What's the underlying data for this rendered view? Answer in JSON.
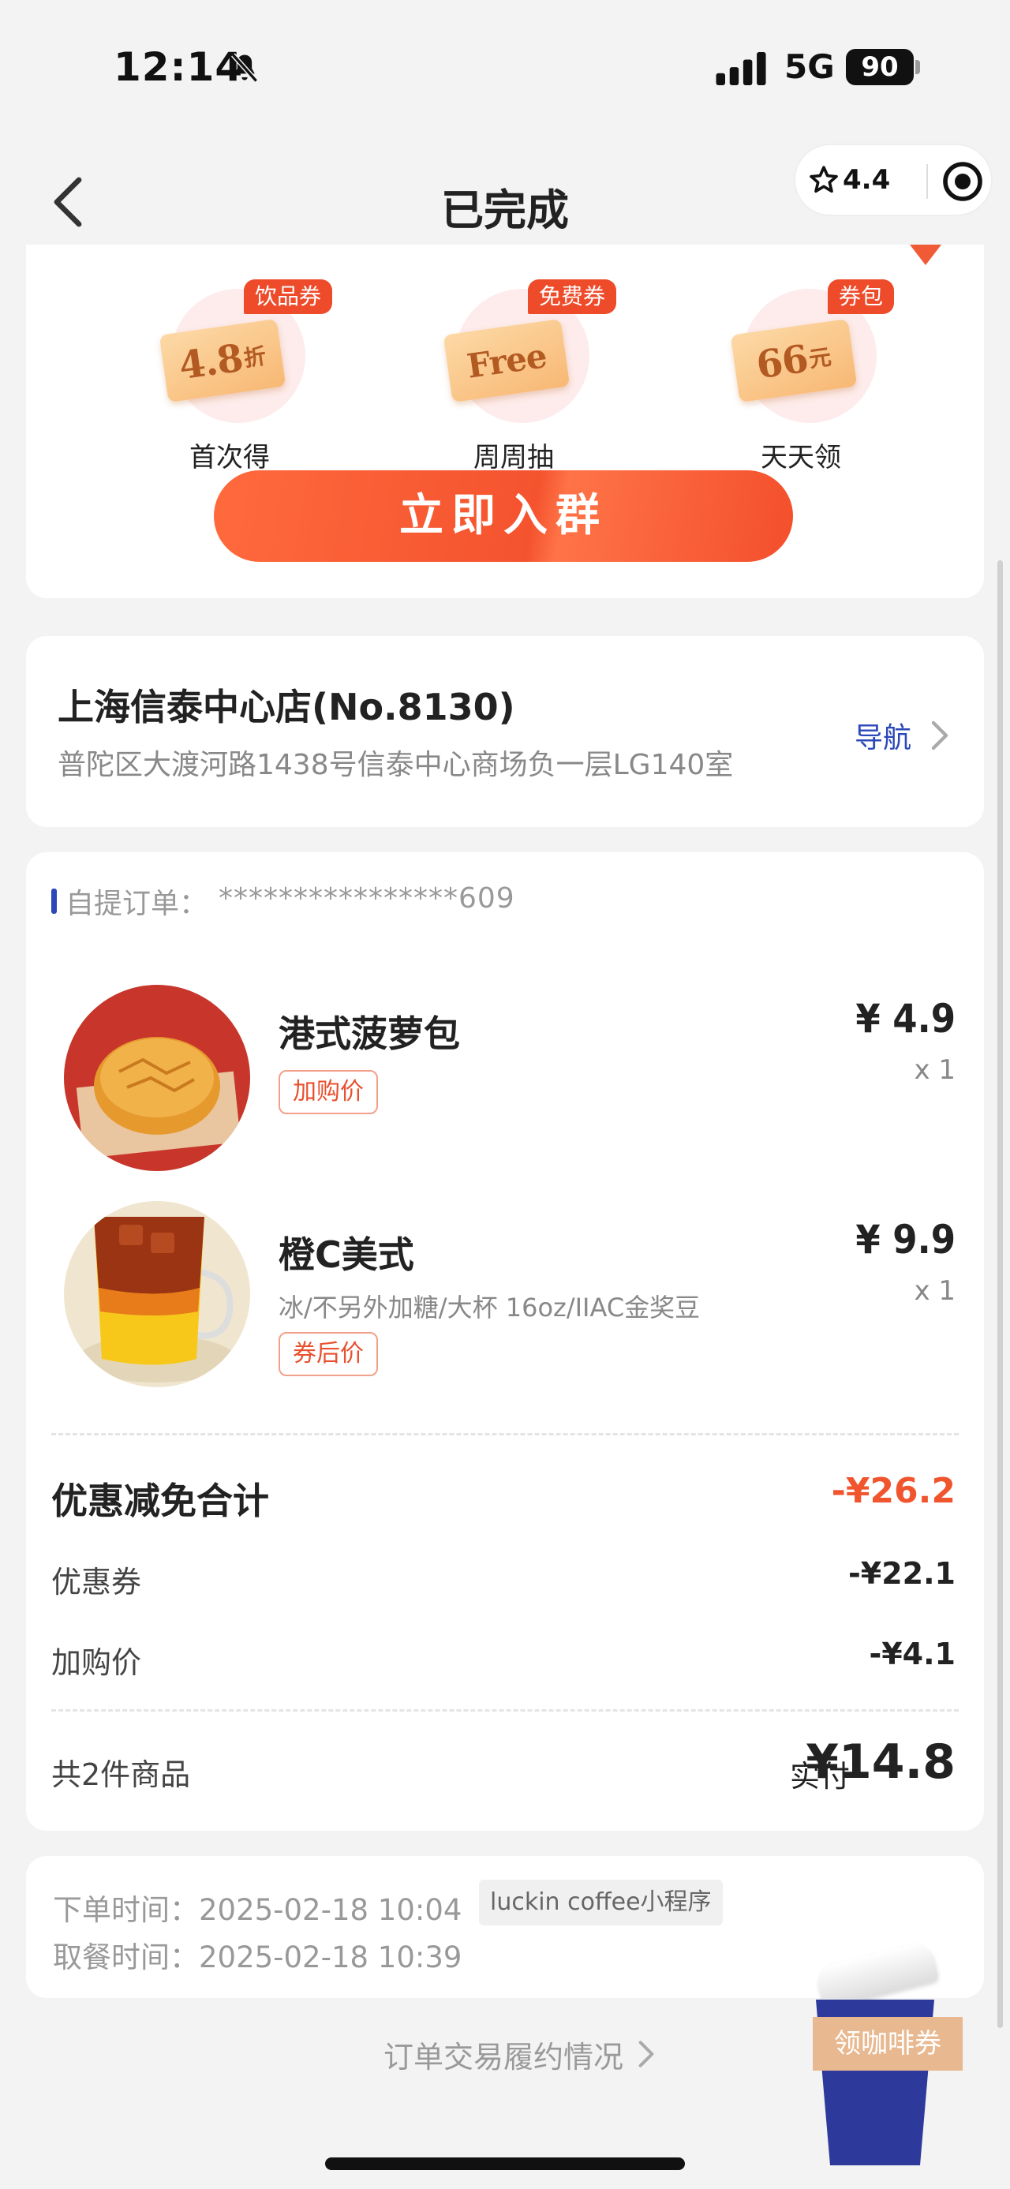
{
  "status_bar": {
    "time": "12:14",
    "network": "5G",
    "battery": "90"
  },
  "nav": {
    "title": "已完成",
    "rating": "4.4"
  },
  "promo": {
    "coupons": [
      {
        "tag": "饮品券",
        "value": "4.8",
        "unit": "折",
        "label": "首次得"
      },
      {
        "tag": "免费券",
        "value": "Free",
        "unit": "",
        "label": "周周抽"
      },
      {
        "tag": "券包",
        "value": "66",
        "unit": "元",
        "label": "天天领"
      }
    ],
    "join_label": "立即入群"
  },
  "store": {
    "name": "上海信泰中心店(No.8130)",
    "address": "普陀区大渡河路1438号信泰中心商场负一层LG140室",
    "nav_label": "导航"
  },
  "order": {
    "type_label": "自提订单：",
    "number": "****************609",
    "items": [
      {
        "name": "港式菠萝包",
        "spec": "",
        "tag": "加购价",
        "price": "¥ 4.9",
        "qty": "x 1"
      },
      {
        "name": "橙C美式",
        "spec": "冰/不另外加糖/大杯 16oz/IIAC金奖豆",
        "tag": "券后价",
        "price": "¥ 9.9",
        "qty": "x 1"
      }
    ],
    "discount": {
      "title": "优惠减免合计",
      "total": "-¥26.2",
      "rows": [
        {
          "label": "优惠券",
          "value": "-¥22.1"
        },
        {
          "label": "加购价",
          "value": "-¥4.1"
        }
      ]
    },
    "summary": {
      "count": "共2件商品",
      "paid_label": "实付",
      "paid_value": "¥14.8"
    }
  },
  "times": {
    "order_label": "下单时间：",
    "order_time": "2025-02-18 10:04",
    "channel": "luckin coffee小程序",
    "pickup_label": "取餐时间：",
    "pickup_time": "2025-02-18 10:39"
  },
  "fulfill_link": "订单交易履约情况",
  "coffee_widget": "领咖啡券",
  "colors": {
    "accent_orange": "#f4532e",
    "brand_blue": "#2b47b8",
    "discount_red": "#f0552d"
  }
}
